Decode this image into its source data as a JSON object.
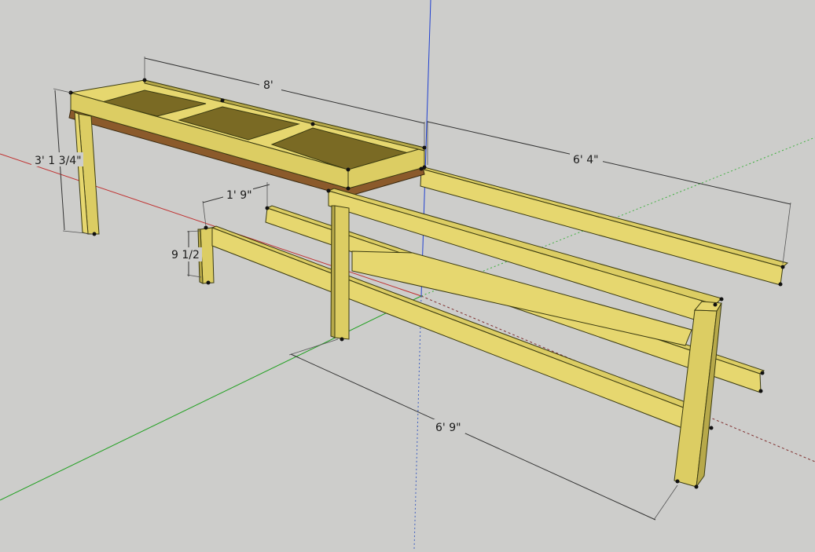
{
  "dimensions": {
    "top_length": "8'",
    "bench_height": "3' 1 3/4\"",
    "rail_spacing": "1' 9\"",
    "rail_height": "9 1/2",
    "rail_length": "6' 4\"",
    "base_length": "6' 9\""
  },
  "colors": {
    "background": "#cdcdcb",
    "wood": "#dccd63",
    "plywood": "#7a6a24",
    "axis_red": "#c03030",
    "axis_green": "#20a020",
    "axis_blue": "#2040d0"
  }
}
